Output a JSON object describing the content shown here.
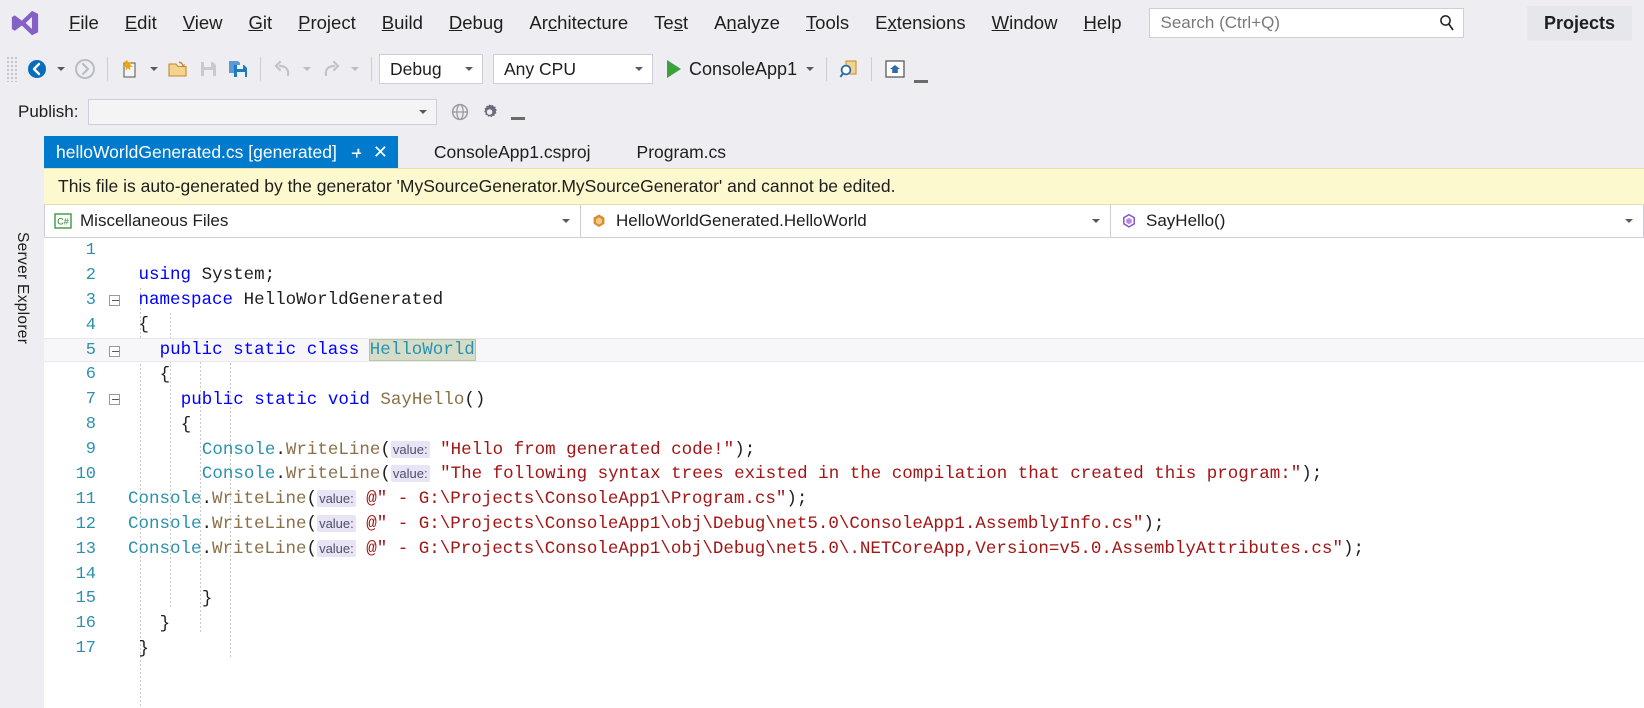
{
  "menu": {
    "logo_icon": "visual-studio-logo",
    "items": [
      {
        "label": "File",
        "accel": "F"
      },
      {
        "label": "Edit",
        "accel": "E"
      },
      {
        "label": "View",
        "accel": "V"
      },
      {
        "label": "Git",
        "accel": "G"
      },
      {
        "label": "Project",
        "accel": "P"
      },
      {
        "label": "Build",
        "accel": "B"
      },
      {
        "label": "Debug",
        "accel": "D"
      },
      {
        "label": "Architecture",
        "accel": "c"
      },
      {
        "label": "Test",
        "accel": "s"
      },
      {
        "label": "Analyze",
        "accel": "n"
      },
      {
        "label": "Tools",
        "accel": "T"
      },
      {
        "label": "Extensions",
        "accel": "x"
      },
      {
        "label": "Window",
        "accel": "W"
      },
      {
        "label": "Help",
        "accel": "H"
      }
    ],
    "search_placeholder": "Search (Ctrl+Q)",
    "search_value": "",
    "search_icon": "magnifier-icon",
    "projects_label": "Projects"
  },
  "toolbar": {
    "back_icon": "navigate-back-icon",
    "forward_icon": "navigate-forward-icon",
    "new_project_icon": "new-project-icon",
    "open_file_icon": "open-file-icon",
    "save_icon": "save-icon",
    "save_all_icon": "save-all-icon",
    "undo_icon": "undo-icon",
    "redo_icon": "redo-icon",
    "configuration": "Debug",
    "platform": "Any CPU",
    "run_label": "ConsoleApp1",
    "run_icon": "play-icon",
    "search_tool_icon": "find-icon",
    "preview_icon": "preview-changes-icon",
    "overflow_icon": "toolbar-overflow-icon"
  },
  "publish": {
    "label": "Publish:",
    "value": "",
    "globe_icon": "globe-icon",
    "gear_icon": "gear-icon",
    "overflow_icon": "toolbar-overflow-icon"
  },
  "rail": {
    "server_explorer": "Server Explorer"
  },
  "tabs": [
    {
      "label": "helloWorldGenerated.cs [generated]",
      "active": true,
      "pin_icon": "pin-icon",
      "close_icon": "close-icon"
    },
    {
      "label": "ConsoleApp1.csproj",
      "active": false
    },
    {
      "label": "Program.cs",
      "active": false
    }
  ],
  "banner": {
    "text": "This file is auto-generated by the generator 'MySourceGenerator.MySourceGenerator' and cannot be edited."
  },
  "navbar": {
    "project": "Miscellaneous Files",
    "project_icon": "csharp-file-icon",
    "type": "HelloWorldGenerated.HelloWorld",
    "type_icon": "class-icon",
    "member": "SayHello()",
    "member_icon": "method-icon",
    "caret_icon": "chevron-down-icon"
  },
  "editor": {
    "line_numbers": [
      "1",
      "2",
      "3",
      "4",
      "5",
      "6",
      "7",
      "8",
      "9",
      "10",
      "11",
      "12",
      "13",
      "14",
      "15",
      "16",
      "17"
    ],
    "lines": [
      {
        "n": "1",
        "indent": 0,
        "tokens": []
      },
      {
        "n": "2",
        "indent": 1,
        "tokens": [
          {
            "t": "using",
            "c": "kw"
          },
          {
            "t": " ",
            "c": "plain"
          },
          {
            "t": "System;",
            "c": "plain"
          }
        ]
      },
      {
        "n": "3",
        "indent": 1,
        "collapse": true,
        "tokens": [
          {
            "t": "namespace",
            "c": "kw"
          },
          {
            "t": " HelloWorldGenerated",
            "c": "plain"
          }
        ]
      },
      {
        "n": "4",
        "indent": 1,
        "tokens": [
          {
            "t": "{",
            "c": "plain"
          }
        ]
      },
      {
        "n": "5",
        "indent": 3,
        "collapse": true,
        "current": true,
        "tokens": [
          {
            "t": "public",
            "c": "kw"
          },
          {
            "t": " ",
            "c": "plain"
          },
          {
            "t": "static",
            "c": "kw"
          },
          {
            "t": " ",
            "c": "plain"
          },
          {
            "t": "class",
            "c": "kw"
          },
          {
            "t": " ",
            "c": "plain"
          },
          {
            "t": "HelloWorld",
            "c": "selbox"
          }
        ]
      },
      {
        "n": "6",
        "indent": 3,
        "tokens": [
          {
            "t": "{",
            "c": "plain"
          }
        ]
      },
      {
        "n": "7",
        "indent": 5,
        "collapse": true,
        "tokens": [
          {
            "t": "public",
            "c": "kw"
          },
          {
            "t": " ",
            "c": "plain"
          },
          {
            "t": "static",
            "c": "kw"
          },
          {
            "t": " ",
            "c": "plain"
          },
          {
            "t": "void",
            "c": "kw"
          },
          {
            "t": " ",
            "c": "plain"
          },
          {
            "t": "SayHello",
            "c": "mth"
          },
          {
            "t": "()",
            "c": "plain"
          }
        ]
      },
      {
        "n": "8",
        "indent": 5,
        "tokens": [
          {
            "t": "{",
            "c": "plain"
          }
        ]
      },
      {
        "n": "9",
        "indent": 7,
        "tokens": [
          {
            "t": "Console",
            "c": "typ"
          },
          {
            "t": ".",
            "c": "plain"
          },
          {
            "t": "WriteLine",
            "c": "mth"
          },
          {
            "t": "(",
            "c": "plain"
          },
          {
            "t": "value:",
            "c": "hint"
          },
          {
            "t": " ",
            "c": "plain"
          },
          {
            "t": "\"Hello from generated code!\"",
            "c": "str"
          },
          {
            "t": ");",
            "c": "plain"
          }
        ]
      },
      {
        "n": "10",
        "indent": 7,
        "tokens": [
          {
            "t": "Console",
            "c": "typ"
          },
          {
            "t": ".",
            "c": "plain"
          },
          {
            "t": "WriteLine",
            "c": "mth"
          },
          {
            "t": "(",
            "c": "plain"
          },
          {
            "t": "value:",
            "c": "hint"
          },
          {
            "t": " ",
            "c": "plain"
          },
          {
            "t": "\"The following syntax trees existed in the compilation that created this program:\"",
            "c": "str"
          },
          {
            "t": ");",
            "c": "plain"
          }
        ]
      },
      {
        "n": "11",
        "indent": 0,
        "tokens": [
          {
            "t": "Console",
            "c": "typ"
          },
          {
            "t": ".",
            "c": "plain"
          },
          {
            "t": "WriteLine",
            "c": "mth"
          },
          {
            "t": "(",
            "c": "plain"
          },
          {
            "t": "value:",
            "c": "hint"
          },
          {
            "t": " ",
            "c": "plain"
          },
          {
            "t": "@\" - G:\\Projects\\ConsoleApp1\\Program.cs\"",
            "c": "str"
          },
          {
            "t": ");",
            "c": "plain"
          }
        ]
      },
      {
        "n": "12",
        "indent": 0,
        "tokens": [
          {
            "t": "Console",
            "c": "typ"
          },
          {
            "t": ".",
            "c": "plain"
          },
          {
            "t": "WriteLine",
            "c": "mth"
          },
          {
            "t": "(",
            "c": "plain"
          },
          {
            "t": "value:",
            "c": "hint"
          },
          {
            "t": " ",
            "c": "plain"
          },
          {
            "t": "@\" - G:\\Projects\\ConsoleApp1\\obj\\Debug\\net5.0\\ConsoleApp1.AssemblyInfo.cs\"",
            "c": "str"
          },
          {
            "t": ");",
            "c": "plain"
          }
        ]
      },
      {
        "n": "13",
        "indent": 0,
        "tokens": [
          {
            "t": "Console",
            "c": "typ"
          },
          {
            "t": ".",
            "c": "plain"
          },
          {
            "t": "WriteLine",
            "c": "mth"
          },
          {
            "t": "(",
            "c": "plain"
          },
          {
            "t": "value:",
            "c": "hint"
          },
          {
            "t": " ",
            "c": "plain"
          },
          {
            "t": "@\" - G:\\Projects\\ConsoleApp1\\obj\\Debug\\net5.0\\.NETCoreApp,Version=v5.0.AssemblyAttributes.cs\"",
            "c": "str"
          },
          {
            "t": ");",
            "c": "plain"
          }
        ]
      },
      {
        "n": "14",
        "indent": 0,
        "tokens": []
      },
      {
        "n": "15",
        "indent": 7,
        "tokens": [
          {
            "t": "}",
            "c": "plain"
          }
        ]
      },
      {
        "n": "16",
        "indent": 3,
        "tokens": [
          {
            "t": "}",
            "c": "plain"
          }
        ]
      },
      {
        "n": "17",
        "indent": 1,
        "tokens": [
          {
            "t": "}",
            "c": "plain"
          }
        ]
      }
    ]
  },
  "colors": {
    "accent": "#007acc",
    "chrome": "#eeeef2",
    "banner_bg": "#fdf9ce",
    "keyword": "#0000ff",
    "type": "#2b91af",
    "method": "#8a7048",
    "string": "#a31515",
    "linenumber": "#2b91af",
    "run_green": "#3ba23b"
  }
}
